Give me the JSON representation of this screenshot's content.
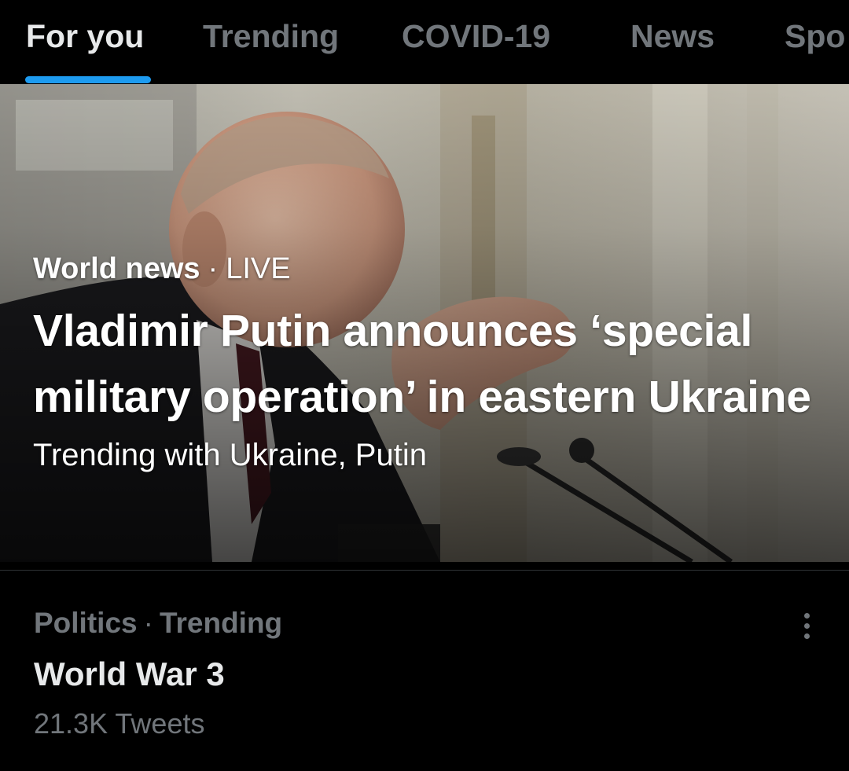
{
  "tabs": [
    {
      "label": "For you",
      "active": true
    },
    {
      "label": "Trending",
      "active": false
    },
    {
      "label": "COVID-19",
      "active": false
    },
    {
      "label": "News",
      "active": false
    },
    {
      "label": "Spo",
      "active": false
    }
  ],
  "hero": {
    "category": "World news",
    "separator": "·",
    "status": "LIVE",
    "headline": "Vladimir Putin announces ‘special military operation’ in eastern Ukraine",
    "subtitle": "Trending with Ukraine, Putin",
    "image_subject": "photo-of-speaker-at-microphones"
  },
  "trend": {
    "category": "Politics",
    "separator": "·",
    "status": "Trending",
    "title": "World War 3",
    "count": "21.3K Tweets",
    "more_icon": "more-vertical-icon"
  },
  "colors": {
    "background": "#000000",
    "accent": "#1d9bf0",
    "text_primary": "#e7e9ea",
    "text_secondary": "#71767b",
    "divider": "#2f3336"
  }
}
